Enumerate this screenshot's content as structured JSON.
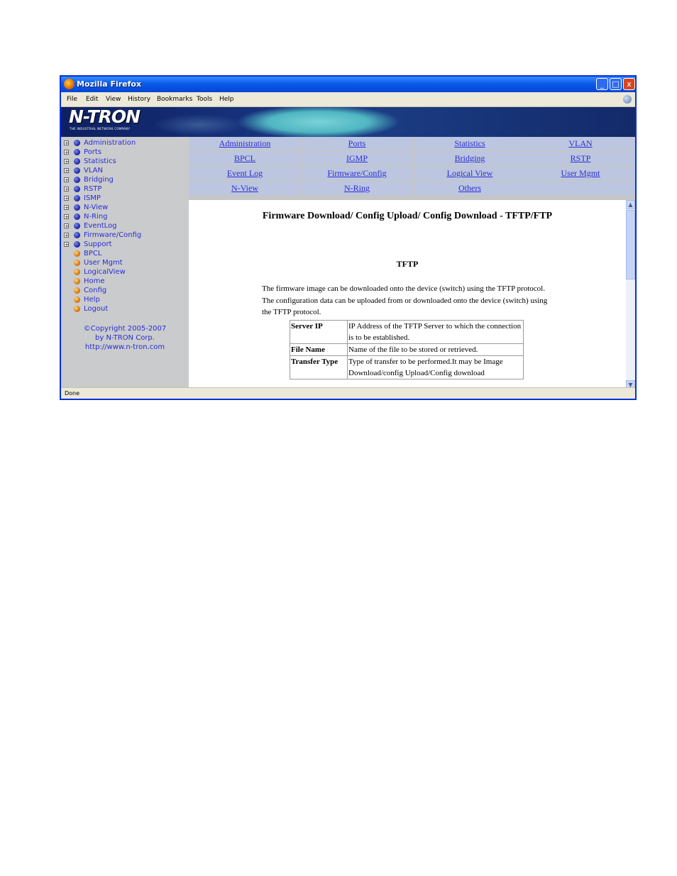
{
  "window": {
    "title": "Mozilla Firefox",
    "min": "_",
    "max": "□",
    "close": "x"
  },
  "menu": [
    "File",
    "Edit",
    "View",
    "History",
    "Bookmarks",
    "Tools",
    "Help"
  ],
  "logo": {
    "text": "N-TRON",
    "tagline": "THE INDUSTRIAL NETWORK COMPANY"
  },
  "sidebar": {
    "folders": [
      "Administration",
      "Ports",
      "Statistics",
      "VLAN",
      "Bridging",
      "RSTP",
      "ISMP",
      "N-View",
      "N-Ring",
      "EventLog",
      "Firmware/Config",
      "Support"
    ],
    "pages": [
      "BPCL",
      "User Mgmt",
      "LogicalView",
      "Home",
      "Config",
      "Help",
      "Logout"
    ],
    "copyright": [
      "©Copyright 2005-2007",
      "by N-TRON Corp.",
      "http://www.n-tron.com"
    ]
  },
  "nav": [
    [
      "Administration",
      "Ports",
      "Statistics",
      "VLAN"
    ],
    [
      "BPCL",
      "IGMP",
      "Bridging",
      "RSTP"
    ],
    [
      "Event Log",
      "Firmware/Config",
      "Logical View",
      "User Mgmt"
    ],
    [
      "N-View",
      "N-Ring",
      "Others",
      ""
    ]
  ],
  "content": {
    "title": "Firmware Download/ Config Upload/ Config Download - TFTP/FTP",
    "section": "TFTP",
    "paragraph": "The firmware image can be downloaded onto the device (switch) using the TFTP protocol. The configuration data can be uploaded from or downloaded onto the device (switch) using the TFTP protocol.",
    "table": [
      {
        "key": "Server IP",
        "value": "IP Address of the TFTP Server to which the connection is to be established."
      },
      {
        "key": "File Name",
        "value": "Name of the file to be stored or retrieved."
      },
      {
        "key": "Transfer Type",
        "value": "Type of transfer to be performed.It may be Image Download/config Upload/Config download"
      }
    ]
  },
  "status": "Done"
}
